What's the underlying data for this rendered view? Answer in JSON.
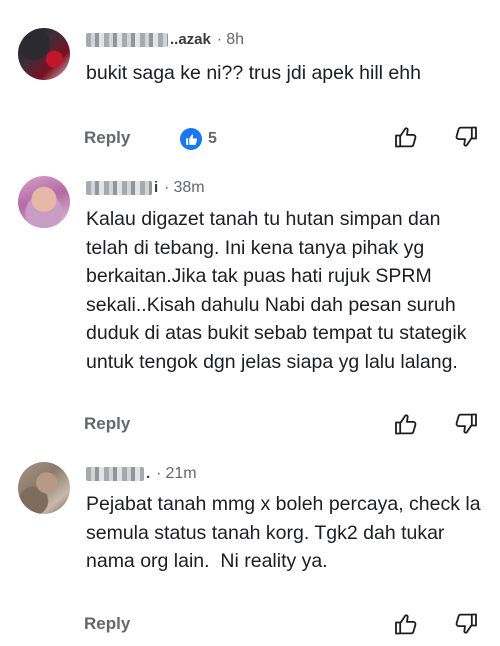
{
  "comments": [
    {
      "name_visible": "..azak",
      "time": "8h",
      "text": "bukit saga ke ni?? trus jdi apek hill ehh",
      "reply_label": "Reply",
      "reaction_count": "5",
      "reaction_icon": "like-icon",
      "name_blurred": true
    },
    {
      "name_visible": "i",
      "time": "38m",
      "text": "Kalau digazet tanah tu hutan simpan dan telah di tebang. Ini kena tanya pihak yg berkaitan.Jika tak puas hati rujuk SPRM sekali..Kisah dahulu Nabi dah pesan suruh duduk di atas bukit sebab tempat tu stategik untuk tengok dgn jelas siapa yg lalu lalang.",
      "reply_label": "Reply",
      "name_blurred": true
    },
    {
      "name_visible": ".",
      "time": "21m",
      "text": "Pejabat tanah mmg x boleh percaya, check la semula status tanah korg. Tgk2 dah tukar nama org lain.  Ni reality ya.",
      "reply_label": "Reply",
      "name_blurred": true
    }
  ],
  "colors": {
    "secondary_text": "#65676b",
    "primary_text": "#1c1e21",
    "like_blue": "#1877f2"
  },
  "icons": {
    "like": "thumbs-up-outline-icon",
    "dislike": "thumbs-down-outline-icon"
  }
}
